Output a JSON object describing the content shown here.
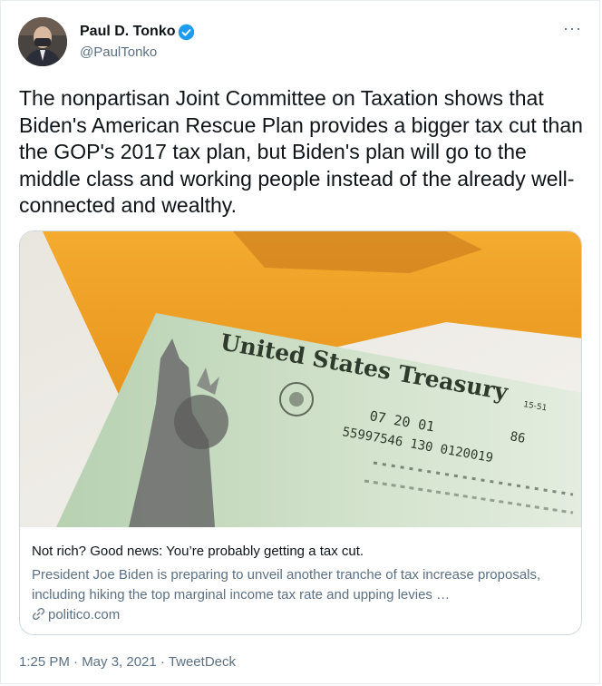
{
  "tweet": {
    "author_name": "Paul D. Tonko",
    "handle": "@PaulTonko",
    "more_label": "···",
    "text": "The nonpartisan Joint Committee on Taxation shows that Biden's American Rescue Plan provides a bigger tax cut than the GOP's 2017 tax plan, but Biden's plan will go to the middle class and working people instead of the already well-connected and wealthy.",
    "timestamp": "1:25 PM · May 3, 2021 · TweetDeck"
  },
  "card": {
    "title": "Not rich? Good news: You’re probably getting a tax cut.",
    "description": "President Joe Biden is preparing to unveil another tranche of tax increase proposals, including hiking the top marginal income tax rate and upping levies …",
    "domain": "politico.com",
    "image": {
      "heading": "United States Treasury",
      "date_line": "07  20  01",
      "number_line": "55997546   130   0120019",
      "check_code": "86",
      "routing": "15-51"
    }
  },
  "colors": {
    "verified": "#1d9bf0",
    "envelope": "#f3a427",
    "check": "#c9dcc4"
  },
  "icons": [
    "verified-badge-icon",
    "more-icon",
    "link-icon"
  ]
}
